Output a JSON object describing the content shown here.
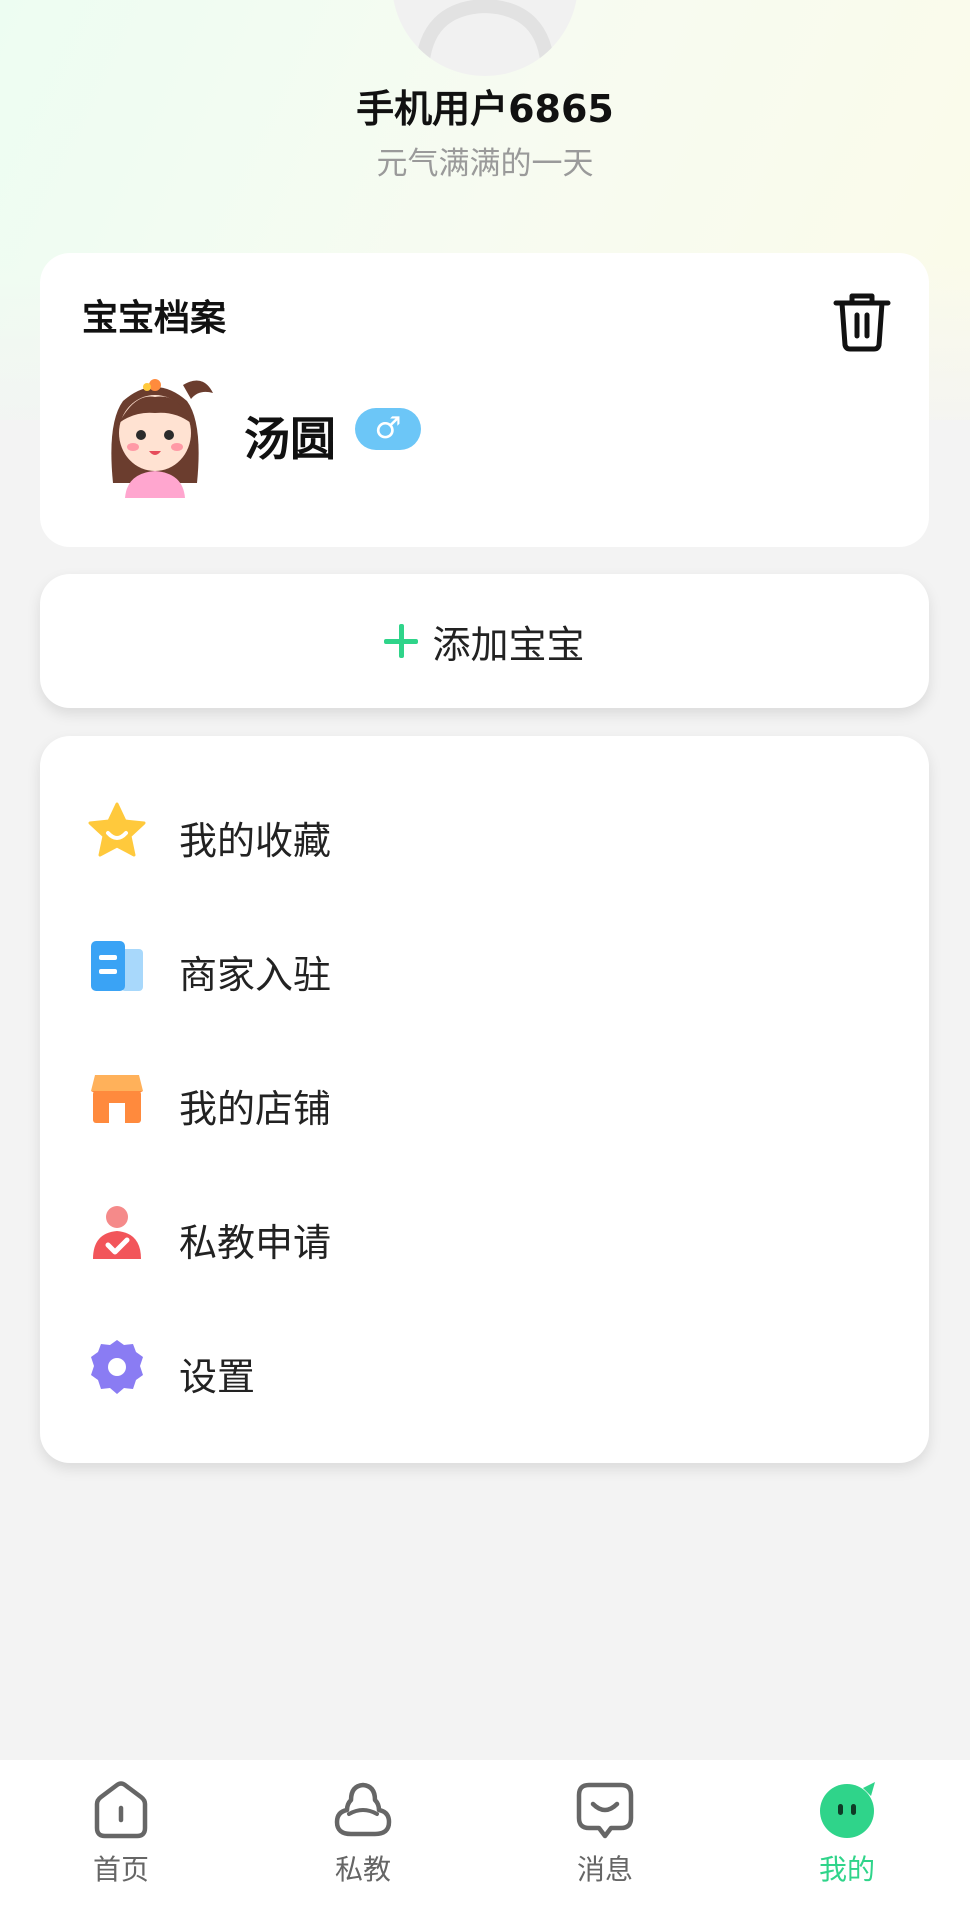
{
  "profile": {
    "name": "手机用户6865",
    "motto": "元气满满的一天",
    "avatar_icon": "default-user-avatar"
  },
  "baby_card": {
    "title": "宝宝档案",
    "delete_icon": "trash-icon",
    "baby": {
      "name": "汤圆",
      "gender_symbol": "♂",
      "avatar_icon": "cartoon-girl-avatar"
    }
  },
  "add_baby": {
    "label": "添加宝宝",
    "icon": "plus-icon",
    "accent_color": "#2fd48a"
  },
  "menu": {
    "items": [
      {
        "label": "我的收藏",
        "icon": "star-icon",
        "color": "#ffc93c"
      },
      {
        "label": "商家入驻",
        "icon": "building-icon",
        "color": "#3aa3f5"
      },
      {
        "label": "我的店铺",
        "icon": "shop-icon",
        "color": "#ff8a3d"
      },
      {
        "label": "私教申请",
        "icon": "person-check-icon",
        "color": "#f2555a"
      },
      {
        "label": "设置",
        "icon": "gear-icon",
        "color": "#8a7cf3"
      }
    ]
  },
  "tabbar": {
    "active_color": "#2fd48a",
    "tabs": [
      {
        "label": "首页",
        "icon": "home-icon",
        "active": false
      },
      {
        "label": "私教",
        "icon": "cloud-icon",
        "active": false
      },
      {
        "label": "消息",
        "icon": "message-icon",
        "active": false
      },
      {
        "label": "我的",
        "icon": "mascot-icon",
        "active": true
      }
    ]
  }
}
